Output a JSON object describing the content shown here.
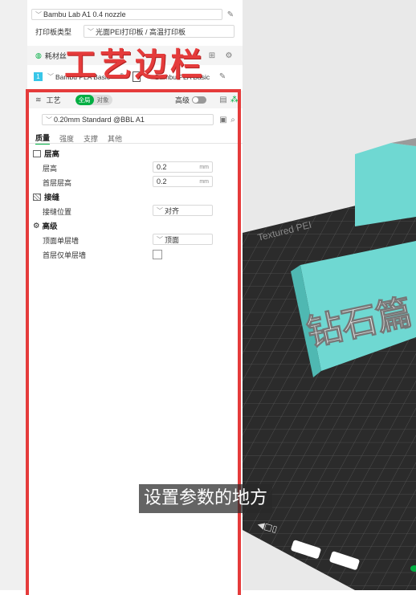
{
  "printer": {
    "name": "Bambu Lab A1 0.4 nozzle"
  },
  "plate": {
    "label": "打印板类型",
    "value": "光面PEI打印板 / 高温打印板"
  },
  "filament": {
    "section_label": "耗材丝",
    "slot_number": "1",
    "slot1_name": "Bambu PLA Basic",
    "slot2_name": "Bambu PLA Basic"
  },
  "overlay_title": "工艺边栏",
  "process": {
    "title": "工艺",
    "toggle_global": "全局",
    "toggle_object": "对象",
    "advanced_label": "高级",
    "preset": "0.20mm Standard @BBL A1",
    "tabs": [
      "质量",
      "强度",
      "支撑",
      "其他"
    ],
    "sections": {
      "layer_height": {
        "title": "层高",
        "rows": [
          {
            "label": "层高",
            "value": "0.2",
            "unit": "mm"
          },
          {
            "label": "首层层高",
            "value": "0.2",
            "unit": "mm"
          }
        ]
      },
      "seam": {
        "title": "接缝",
        "rows": [
          {
            "label": "接缝位置",
            "value": "对齐"
          }
        ]
      },
      "advanced": {
        "title": "高级",
        "rows": [
          {
            "label": "顶面单层墙",
            "value": "顶面"
          },
          {
            "label": "首层仅单层墙",
            "value": ""
          }
        ]
      }
    }
  },
  "model_text": "钻石篇",
  "plate_text": "Textured PEI",
  "subtitle": "设置参数的地方",
  "colors": {
    "accent_red": "#e53b3b",
    "badge_green": "#00ae42",
    "model_cyan": "#6fd8d2",
    "plate_dark": "#2b2b2b"
  }
}
